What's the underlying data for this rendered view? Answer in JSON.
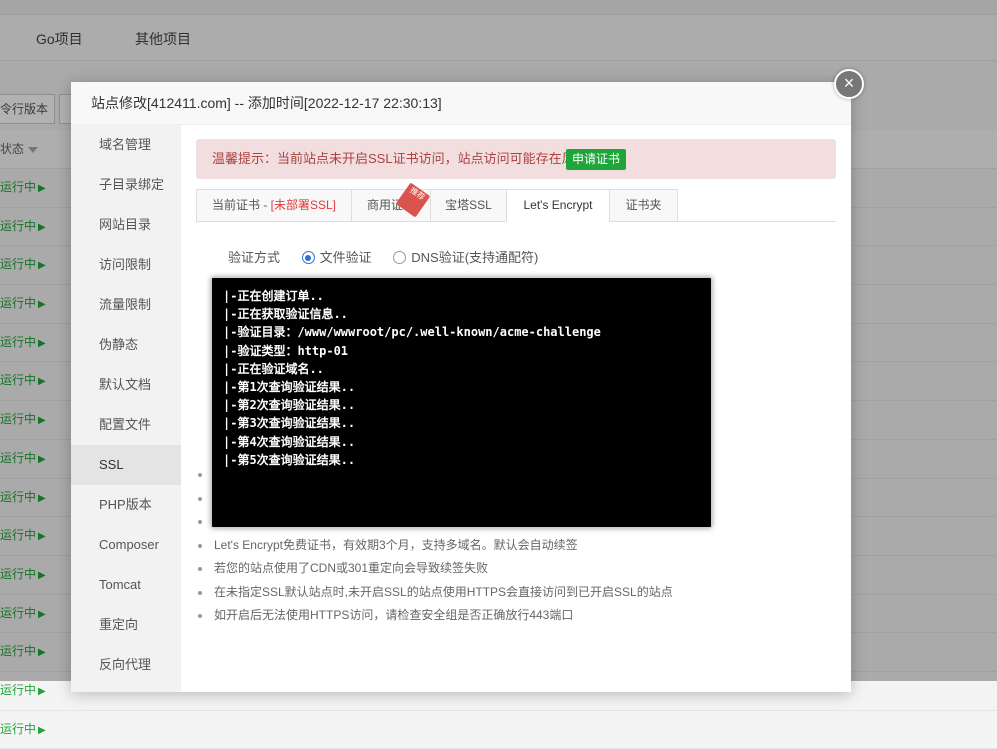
{
  "background": {
    "nav": [
      "Go项目",
      "其他项目"
    ],
    "toolbar": {
      "btn1": "令行版本"
    },
    "table_header": "状态",
    "row_status": "运行中",
    "row_count": 15
  },
  "modal": {
    "title": "站点修改[412411.com] -- 添加时间[2022-12-17 22:30:13]",
    "close": "×",
    "sidebar": [
      "域名管理",
      "子目录绑定",
      "网站目录",
      "访问限制",
      "流量限制",
      "伪静态",
      "默认文档",
      "配置文件",
      "SSL",
      "PHP版本",
      "Composer",
      "Tomcat",
      "重定向",
      "反向代理"
    ],
    "sidebar_active": "SSL",
    "alert": {
      "text": "温馨提示：当前站点未开启SSL证书访问，站点访问可能存在风险。",
      "button": "申请证书"
    },
    "tabs": {
      "current_prefix": "当前证书 - ",
      "current_status": "[未部署SSL]",
      "commercial": "商用证书",
      "ribbon": "推荐",
      "baota": "宝塔SSL",
      "letsencrypt": "Let's Encrypt",
      "folder": "证书夹"
    },
    "verify": {
      "label": "验证方式",
      "option_file": "文件验证",
      "option_dns": "DNS验证(支持通配符)",
      "selected": "文件验证"
    },
    "notes": [
      "",
      "",
      "",
      "Let's Encrypt免费证书，有效期3个月，支持多域名。默认会自动续签",
      "若您的站点使用了CDN或301重定向会导致续签失败",
      "在未指定SSL默认站点时,未开启SSL的站点使用HTTPS会直接访问到已开启SSL的站点",
      "如开启后无法使用HTTPS访问，请检查安全组是否正确放行443端口"
    ]
  },
  "terminal": {
    "lines": [
      "|-正在创建订单..",
      "|-正在获取验证信息..",
      "|-验证目录：/www/wwwroot/pc/.well-known/acme-challenge",
      "|-验证类型：http-01",
      "|-正在验证域名..",
      "|-第1次查询验证结果..",
      "|-第2次查询验证结果..",
      "|-第3次查询验证结果..",
      "|-第4次查询验证结果..",
      "|-第5次查询验证结果.."
    ]
  }
}
